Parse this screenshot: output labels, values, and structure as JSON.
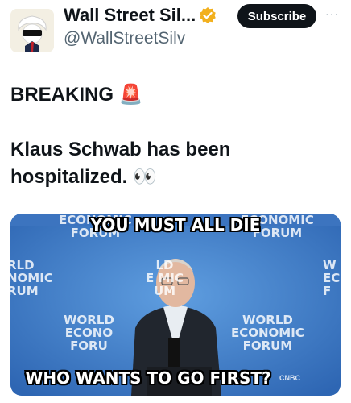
{
  "header": {
    "display_name": "Wall Street Sil...",
    "handle": "@WallStreetSilv",
    "subscribe_label": "Subscribe",
    "more_label": "···",
    "verified_color": "#f2b01e"
  },
  "tweet": {
    "line1": "BREAKING 🚨",
    "line2": "Klaus Schwab has been",
    "line3": "hospitalized. 👀"
  },
  "media": {
    "top_caption": "YOU MUST ALL DIE",
    "bottom_caption": "WHO WANTS TO GO FIRST?",
    "watermark": "CNBC"
  }
}
